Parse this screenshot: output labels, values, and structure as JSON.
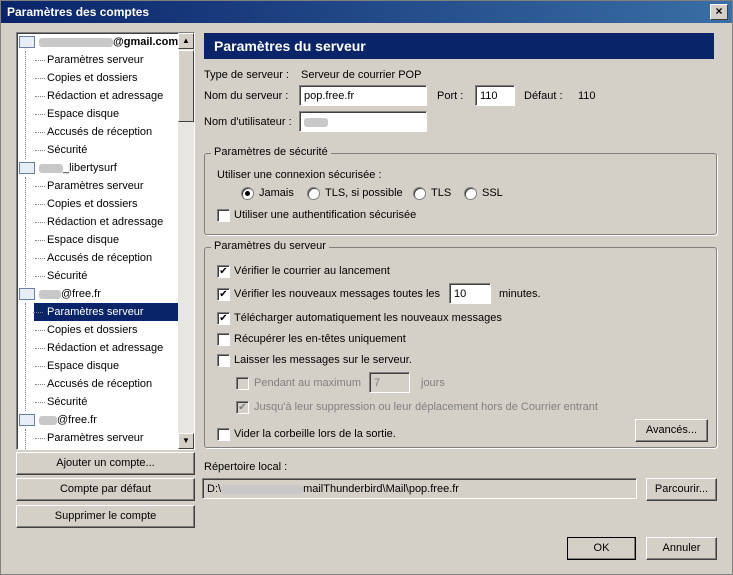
{
  "window": {
    "title": "Paramètres des comptes",
    "close": "×"
  },
  "tree": {
    "accounts": [
      {
        "name_visible": "@gmail.com",
        "items": [
          "Paramètres serveur",
          "Copies et dossiers",
          "Rédaction et adressage",
          "Espace disque",
          "Accusés de réception",
          "Sécurité"
        ]
      },
      {
        "name_visible": "_libertysurf",
        "items": [
          "Paramètres serveur",
          "Copies et dossiers",
          "Rédaction et adressage",
          "Espace disque",
          "Accusés de réception",
          "Sécurité"
        ]
      },
      {
        "name_visible": "@free.fr",
        "items": [
          "Paramètres serveur",
          "Copies et dossiers",
          "Rédaction et adressage",
          "Espace disque",
          "Accusés de réception",
          "Sécurité"
        ]
      },
      {
        "name_visible": "@free.fr",
        "items": [
          "Paramètres serveur"
        ]
      }
    ],
    "selected": "Paramètres serveur"
  },
  "left_buttons": {
    "add": "Ajouter un compte...",
    "default": "Compte par défaut",
    "delete": "Supprimer le compte"
  },
  "panel": {
    "title": "Paramètres du serveur",
    "server_type_label": "Type de serveur :",
    "server_type_value": "Serveur de courrier POP",
    "server_name_label": "Nom du serveur :",
    "server_name_value": "pop.free.fr",
    "port_label": "Port :",
    "port_value": "110",
    "default_label": "Défaut :",
    "default_value": "110",
    "username_label": "Nom d'utilisateur :"
  },
  "security": {
    "legend": "Paramètres de sécurité",
    "prompt": "Utiliser une connexion sécurisée :",
    "options": [
      "Jamais",
      "TLS, si possible",
      "TLS",
      "SSL"
    ],
    "selected": "Jamais",
    "auth_label": "Utiliser une authentification sécurisée",
    "auth_checked": false
  },
  "server_settings": {
    "legend": "Paramètres du serveur",
    "check_startup": "Vérifier le courrier au lancement",
    "check_every": "Vérifier les nouveaux messages toutes les",
    "check_every_value": "10",
    "minutes": "minutes.",
    "auto_download": "Télécharger automatiquement les nouveaux messages",
    "headers_only": "Récupérer les en-têtes uniquement",
    "leave_on_server": "Laisser les messages sur le serveur.",
    "for_max": "Pendant au maximum",
    "for_max_value": "7",
    "days": "jours",
    "until_deleted": "Jusqu'à leur suppression ou leur déplacement hors de Courrier entrant",
    "empty_trash": "Vider la corbeille lors de la sortie.",
    "advanced": "Avancés..."
  },
  "local_dir": {
    "label": "Répertoire local :",
    "value_start": "D:\\",
    "value_end": "mailThunderbird\\Mail\\pop.free.fr",
    "browse": "Parcourir..."
  },
  "dialog_buttons": {
    "ok": "OK",
    "cancel": "Annuler"
  }
}
